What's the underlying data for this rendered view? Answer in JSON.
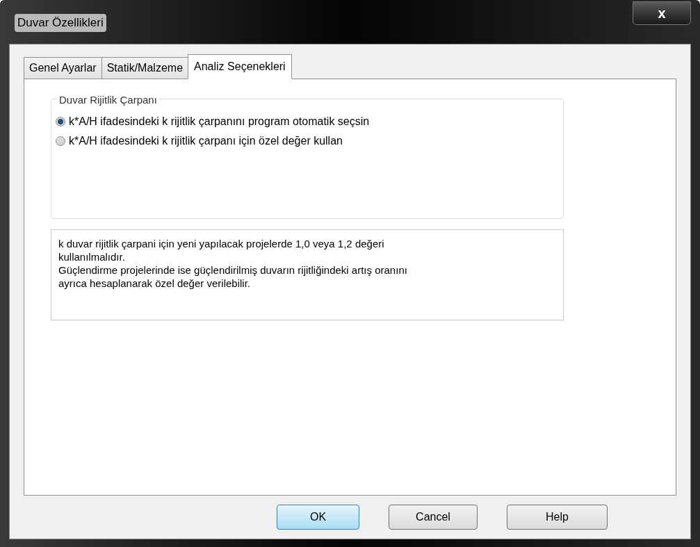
{
  "window": {
    "title": "Duvar Özellikleri",
    "close": "x"
  },
  "tabs": [
    {
      "label": "Genel Ayarlar",
      "selected": false
    },
    {
      "label": "Statik/Malzeme",
      "selected": false
    },
    {
      "label": "Analiz Seçenekleri",
      "selected": true
    }
  ],
  "group": {
    "title": "Duvar Rijitlik Çarpanı",
    "options": [
      {
        "label": "k*A/H ifadesindeki k rijitlik çarpanını program otomatik seçsin",
        "selected": true
      },
      {
        "label": "k*A/H ifadesindeki k rijitlik çarpanı için özel değer kullan",
        "selected": false
      }
    ]
  },
  "info": [
    "k duvar rijitlik çarpani için yeni yapılacak projelerde 1,0 veya 1,2 değeri",
    "kullanılmalıdır.",
    "Güçlendirme projelerinde ise güçlendirilmiş duvarın rijitliğindeki artış oranını",
    "ayrıca hesaplanarak özel değer verilebilir."
  ],
  "buttons": [
    {
      "label": "OK",
      "default": true
    },
    {
      "label": "Cancel",
      "default": false
    },
    {
      "label": "Help",
      "default": false
    }
  ]
}
